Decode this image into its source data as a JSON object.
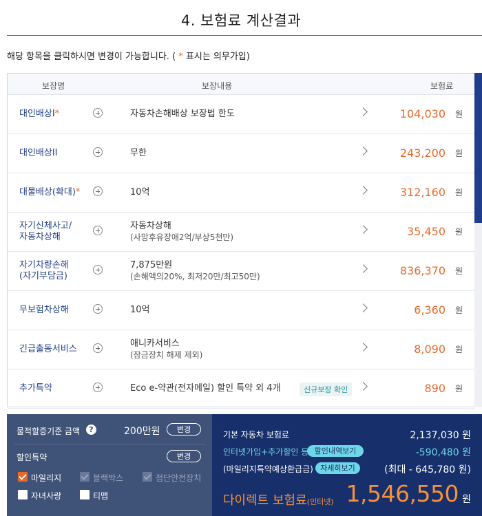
{
  "title": "4. 보험료 계산결과",
  "notice": {
    "prefix": "해당 항목을 클릭하시면 변경이 가능합니다. ( ",
    "star": "*",
    "suffix": " 표시는 의무가입)"
  },
  "table": {
    "headers": {
      "name": "보장명",
      "content": "보장내용",
      "premium": "보험료"
    },
    "currency": "원",
    "rows": [
      {
        "name": "대인배상I",
        "required": "*",
        "desc": "자동차손해배상 보장법 한도",
        "desc_sub": "",
        "badge": "",
        "amount": "104,030"
      },
      {
        "name": "대인배상II",
        "required": "",
        "desc": "무한",
        "desc_sub": "",
        "badge": "",
        "amount": "243,200"
      },
      {
        "name": "대물배상(확대)",
        "required": "*",
        "desc": "10억",
        "desc_sub": "",
        "badge": "",
        "amount": "312,160"
      },
      {
        "name": "자기신체사고/\n자동차상해",
        "required": "",
        "desc": "자동차상해",
        "desc_sub": "(사망후유장애2억/부상5천만)",
        "badge": "",
        "amount": "35,450"
      },
      {
        "name": "자기차량손해\n(자기부담금)",
        "required": "",
        "desc": "7,875만원",
        "desc_sub": "(손해액의20%, 최저20만/최고50만)",
        "badge": "",
        "amount": "836,370"
      },
      {
        "name": "무보험차상해",
        "required": "",
        "desc": "10억",
        "desc_sub": "",
        "badge": "",
        "amount": "6,360"
      },
      {
        "name": "긴급출동서비스",
        "required": "",
        "desc": "애니카서비스",
        "desc_sub": "(잠금장치 해제 제외)",
        "badge": "",
        "amount": "8,090"
      },
      {
        "name": "추가특약",
        "required": "",
        "desc": "Eco e-약관(전자메일) 할인 특약 외 4개",
        "desc_sub": "",
        "badge": "신규보장 확인",
        "amount": "890"
      }
    ]
  },
  "left_panel": {
    "property_label": "물적할증기준 금액",
    "property_help": "?",
    "property_amount": "200만원",
    "change_label": "변경",
    "discount_label": "할인특약",
    "discount_change_label": "변경",
    "options": [
      {
        "label": "마일리지",
        "state": "checked"
      },
      {
        "label": "블랙박스",
        "state": "disabled"
      },
      {
        "label": "첨단안전장치",
        "state": "disabled"
      },
      {
        "label": "자녀사랑",
        "state": "empty"
      },
      {
        "label": "티맵",
        "state": "empty"
      }
    ]
  },
  "right_panel": {
    "base_label": "기본 자동차 보험료",
    "base_value": "2,137,030 원",
    "discount_label": "인터넷가입+추가할인 등",
    "discount_pill": "할인내역보기",
    "discount_value": "-590,480 원",
    "mileage_label": "(마일리지특약예상환급금)",
    "mileage_pill": "자세히보기",
    "mileage_value": "(최대 - 645,780 원)",
    "final_label": "다이렉트 보험료",
    "final_label_small": "(인터넷)",
    "final_amount": "1,546,550",
    "final_won": "원"
  },
  "colors": {
    "accent": "#e8692a",
    "navy": "#172f6b",
    "slate": "#3f5277",
    "cyan": "#6fd6ea",
    "link": "#21408a"
  }
}
